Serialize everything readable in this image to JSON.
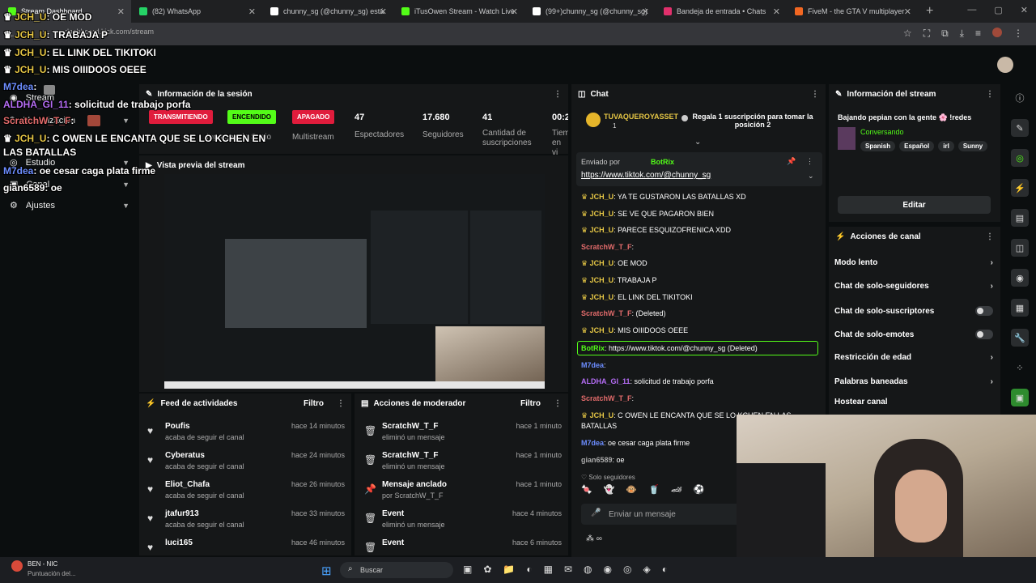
{
  "browser": {
    "tabs": [
      {
        "label": "Stream Dashboard",
        "color": "#53fc18"
      },
      {
        "label": "(82) WhatsApp",
        "color": "#25d366"
      },
      {
        "label": "chunny_sg (@chunny_sg) está",
        "color": "#ffffff"
      },
      {
        "label": "iTusOwen Stream - Watch Live",
        "color": "#53fc18"
      },
      {
        "label": "(99+)chunny_sg (@chunny_sg)",
        "color": "#ffffff"
      },
      {
        "label": "Bandeja de entrada • Chats",
        "color": "#e1306c"
      },
      {
        "label": "FiveM - the GTA V multiplayer",
        "color": "#f26722"
      }
    ],
    "url": "dashboard.kick.com/stream"
  },
  "overlay_chat": [
    {
      "user": "JCH_U",
      "text": ": OE MOD"
    },
    {
      "user": "JCH_U",
      "text": ": TRABAJA P"
    },
    {
      "user": "JCH_U",
      "text": ": EL LINK DEL TIKITOKI"
    },
    {
      "user": "JCH_U",
      "text": ": MIS OIIIDOOS OEEE"
    },
    {
      "user": "M7dea",
      "text": ":"
    },
    {
      "user": "ALDHA_GI_11",
      "text": ": solicitud de trabajo porfa"
    },
    {
      "user": "ScratchW_T_F",
      "text": ":"
    },
    {
      "user": "JCH_U",
      "text": ": C OWEN LE ENCANTA QUE SE LO KCHEN EN"
    },
    {
      "user": "",
      "text": "LAS BATALLAS"
    },
    {
      "user": "M7dea",
      "text": ": oe cesar caga plata firme"
    },
    {
      "user": "gian6589",
      "text": ": oe"
    }
  ],
  "leftnav": [
    {
      "label": "Stream"
    },
    {
      "label": "Monetización"
    },
    {
      "label": "Estudio"
    },
    {
      "label": "Canal"
    },
    {
      "label": "Ajustes"
    }
  ],
  "session": {
    "title": "Información de la sesión",
    "badges": [
      {
        "label": "TRANSMITIENDO",
        "color": "#e01c3c",
        "sub": "Ingresos de Socio"
      },
      {
        "label": "ENCENDIDO",
        "color": "#53fc18",
        "sub": ""
      },
      {
        "label": "APAGADO",
        "color": "#e01c3c",
        "sub": "Multistream"
      }
    ],
    "stats": [
      {
        "n": "47",
        "l": "Espectadores"
      },
      {
        "n": "17.680",
        "l": "Seguidores"
      },
      {
        "n": "41",
        "l": "Cantidad de suscripciones"
      },
      {
        "n": "00:2",
        "l": "Tiem en vi"
      }
    ]
  },
  "preview": {
    "title": "Vista previa del stream"
  },
  "feed": {
    "title": "Feed de actividades",
    "filter": "Filtro",
    "items": [
      {
        "name": "Poufis",
        "sub": "acaba de seguir el canal",
        "time": "hace 14 minutos"
      },
      {
        "name": "Cyberatus",
        "sub": "acaba de seguir el canal",
        "time": "hace 24 minutos"
      },
      {
        "name": "Eliot_Chafa",
        "sub": "acaba de seguir el canal",
        "time": "hace 26 minutos"
      },
      {
        "name": "jtafur913",
        "sub": "acaba de seguir el canal",
        "time": "hace 33 minutos"
      },
      {
        "name": "luci165",
        "sub": "",
        "time": "hace 46 minutos"
      }
    ]
  },
  "modactions": {
    "title": "Acciones de moderador",
    "filter": "Filtro",
    "items": [
      {
        "name": "ScratchW_T_F",
        "sub": "eliminó un mensaje",
        "time": "hace 1 minuto",
        "icon": "trash-icon"
      },
      {
        "name": "ScratchW_T_F",
        "sub": "eliminó un mensaje",
        "time": "hace 1 minuto",
        "icon": "trash-icon"
      },
      {
        "name": "Mensaje anclado",
        "sub": "por ScratchW_T_F",
        "time": "hace 1 minuto",
        "icon": "pin-icon"
      },
      {
        "name": "Event",
        "sub": "eliminó un mensaje",
        "time": "hace 4 minutos",
        "icon": "trash-icon"
      },
      {
        "name": "Event",
        "sub": "",
        "time": "hace 6 minutos",
        "icon": "trash-icon"
      }
    ]
  },
  "chat": {
    "title": "Chat",
    "top_user": "TUVAQUEROYASSET",
    "top_count": "1",
    "gift_text": "Regala 1 suscripción para tomar la posición 2",
    "pinned_by": "Enviado por",
    "pinned_user": "BotRix",
    "pinned_link": "https://www.tiktok.com/@chunny_sg",
    "lines": [
      {
        "user": "JCH_U",
        "text": ": YA TE GUSTARON LAS BATALLAS XD",
        "color": "#e5c645"
      },
      {
        "user": "JCH_U",
        "text": ": SE VE QUE PAGARON BIEN",
        "color": "#e5c645"
      },
      {
        "user": "JCH_U",
        "text": ": PARECE ESQUIZOFRENICA XDD",
        "color": "#e5c645"
      },
      {
        "user": "ScratchW_T_F",
        "text": ":",
        "color": "#e26b6b"
      },
      {
        "user": "JCH_U",
        "text": ": OE MOD",
        "color": "#e5c645"
      },
      {
        "user": "JCH_U",
        "text": ": TRABAJA P",
        "color": "#e5c645"
      },
      {
        "user": "JCH_U",
        "text": ": EL LINK DEL TIKITOKI",
        "color": "#e5c645"
      },
      {
        "user": "ScratchW_T_F",
        "text": ": (Deleted)",
        "color": "#e26b6b"
      },
      {
        "user": "JCH_U",
        "text": ": MIS OIIIDOOS OEEE",
        "color": "#e5c645"
      },
      {
        "user": "BotRix",
        "text": ": https://www.tiktok.com/@chunny_sg (Deleted)",
        "color": "#53fc18"
      },
      {
        "user": "M7dea",
        "text": ":",
        "color": "#6c8dff"
      },
      {
        "user": "ALDHA_GI_11",
        "text": ": solicitud de trabajo porfa",
        "color": "#b46cf4"
      },
      {
        "user": "ScratchW_T_F",
        "text": ":",
        "color": "#e26b6b"
      },
      {
        "user": "JCH_U",
        "text": ": C OWEN LE ENCANTA QUE SE LO KCHEN EN LAS",
        "color": "#e5c645"
      },
      {
        "user": "",
        "text": "BATALLAS",
        "color": "#ffffff"
      },
      {
        "user": "M7dea",
        "text": ": oe cesar caga plata firme",
        "color": "#6c8dff"
      },
      {
        "user": "gian6589",
        "text": ": oe",
        "color": "#aaaaaa"
      }
    ],
    "mode": "Solo seguidores",
    "input_placeholder": "Enviar un mensaje"
  },
  "streaminfo": {
    "title": "Información del stream",
    "stream_title": "Bajando pepian con la gente 🌸 !redes",
    "category": "Conversando",
    "tags": [
      "Spanish",
      "Español",
      "irl",
      "Sunny"
    ],
    "edit": "Editar"
  },
  "channelactions": {
    "title": "Acciones de canal",
    "items": [
      {
        "label": "Modo lento",
        "type": "chevron"
      },
      {
        "label": "Chat de solo-seguidores",
        "type": "chevron"
      },
      {
        "label": "Chat de solo-suscriptores",
        "type": "toggle"
      },
      {
        "label": "Chat de solo-emotes",
        "type": "toggle"
      },
      {
        "label": "Restricción de edad",
        "type": "chevron"
      },
      {
        "label": "Palabras baneadas",
        "type": "chevron"
      },
      {
        "label": "Hostear canal",
        "type": "none"
      }
    ]
  },
  "taskbar": {
    "weather_title": "BEN - NIC",
    "weather_sub": "Puntuación del...",
    "search": "Buscar"
  }
}
